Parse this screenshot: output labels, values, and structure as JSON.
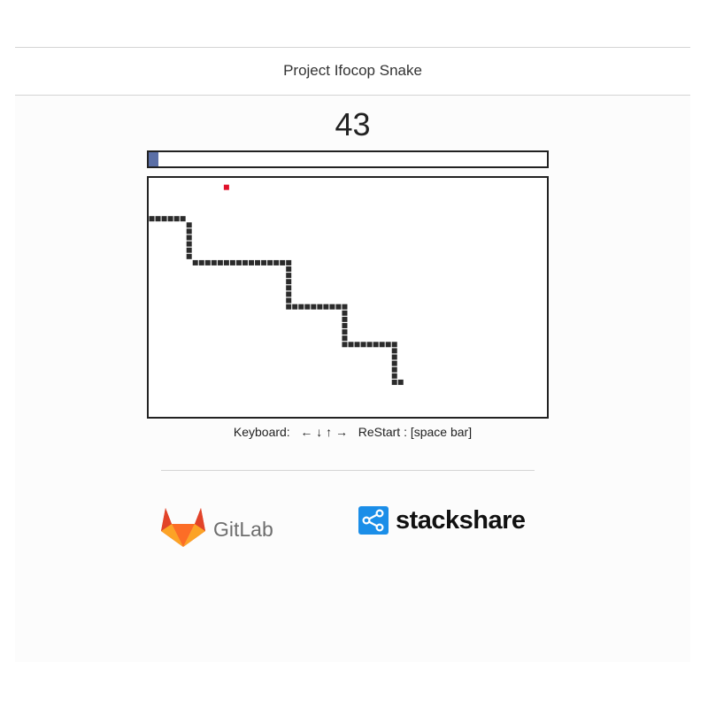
{
  "header": {
    "title": "Project Ifocop Snake"
  },
  "game": {
    "score": "43",
    "progress_fraction": 0.025,
    "grid": {
      "cols": 64,
      "rows": 38
    },
    "food": {
      "col": 12,
      "row": 1
    },
    "snake": [
      [
        0,
        6
      ],
      [
        1,
        6
      ],
      [
        2,
        6
      ],
      [
        3,
        6
      ],
      [
        4,
        6
      ],
      [
        5,
        6
      ],
      [
        6,
        7
      ],
      [
        6,
        8
      ],
      [
        6,
        9
      ],
      [
        6,
        10
      ],
      [
        6,
        11
      ],
      [
        6,
        12
      ],
      [
        7,
        13
      ],
      [
        8,
        13
      ],
      [
        9,
        13
      ],
      [
        10,
        13
      ],
      [
        11,
        13
      ],
      [
        12,
        13
      ],
      [
        13,
        13
      ],
      [
        14,
        13
      ],
      [
        15,
        13
      ],
      [
        16,
        13
      ],
      [
        17,
        13
      ],
      [
        18,
        13
      ],
      [
        19,
        13
      ],
      [
        20,
        13
      ],
      [
        21,
        13
      ],
      [
        22,
        13
      ],
      [
        22,
        14
      ],
      [
        22,
        15
      ],
      [
        22,
        16
      ],
      [
        22,
        17
      ],
      [
        22,
        18
      ],
      [
        22,
        19
      ],
      [
        22,
        20
      ],
      [
        23,
        20
      ],
      [
        24,
        20
      ],
      [
        25,
        20
      ],
      [
        26,
        20
      ],
      [
        27,
        20
      ],
      [
        28,
        20
      ],
      [
        29,
        20
      ],
      [
        30,
        20
      ],
      [
        31,
        20
      ],
      [
        31,
        21
      ],
      [
        31,
        22
      ],
      [
        31,
        23
      ],
      [
        31,
        24
      ],
      [
        31,
        25
      ],
      [
        31,
        26
      ],
      [
        32,
        26
      ],
      [
        33,
        26
      ],
      [
        34,
        26
      ],
      [
        35,
        26
      ],
      [
        36,
        26
      ],
      [
        37,
        26
      ],
      [
        38,
        26
      ],
      [
        39,
        26
      ],
      [
        39,
        27
      ],
      [
        39,
        28
      ],
      [
        39,
        29
      ],
      [
        39,
        30
      ],
      [
        39,
        31
      ],
      [
        39,
        32
      ],
      [
        40,
        32
      ]
    ],
    "colors": {
      "snake": "#2b2b2b",
      "food": "#e0102a",
      "progress": "#5b6fa6"
    }
  },
  "controls": {
    "keyboard_label": "Keyboard:",
    "arrows": [
      "←",
      "↓",
      "↑",
      "→"
    ],
    "restart_label": "ReStart : [space bar]"
  },
  "footer": {
    "gitlab": {
      "name": "GitLab",
      "icon": "gitlab-fox-icon"
    },
    "stackshare": {
      "name": "stackshare",
      "icon": "stackshare-share-icon",
      "color": "#1b8ee8"
    }
  }
}
